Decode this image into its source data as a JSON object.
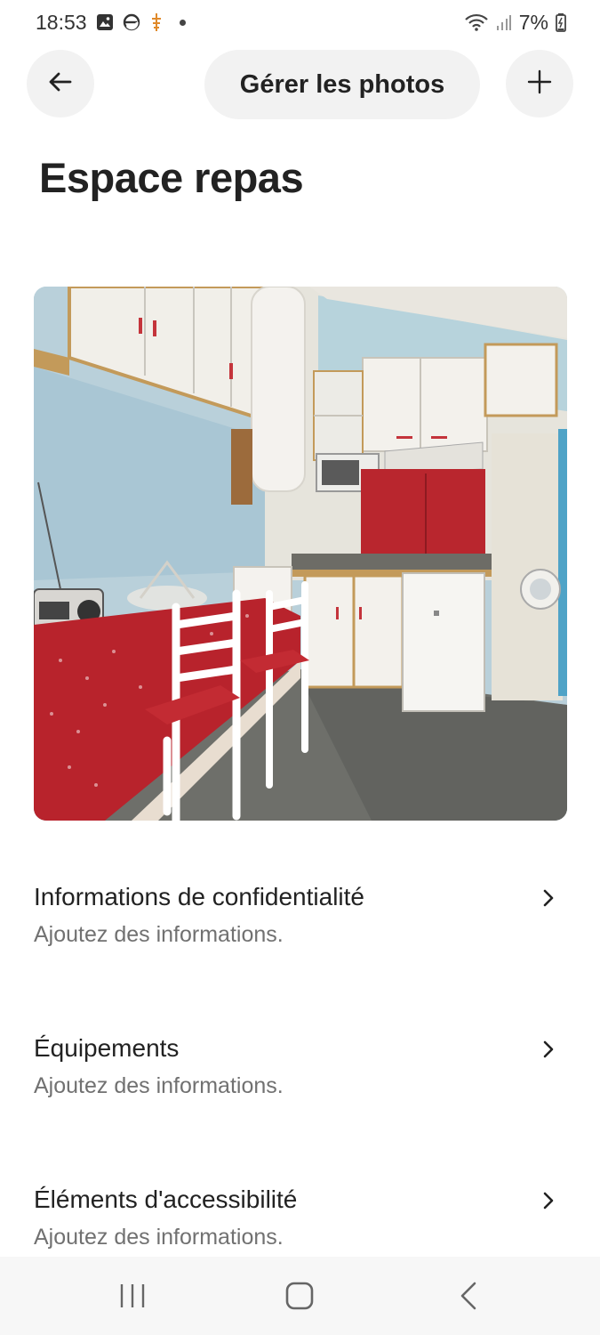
{
  "status_bar": {
    "time": "18:53",
    "battery": "7%",
    "icons": [
      "gallery-icon",
      "edge-browser-icon",
      "app-notification-icon",
      "dot",
      "wifi-icon",
      "signal-icon",
      "battery-charging-icon"
    ]
  },
  "header": {
    "back_icon": "arrow-left-icon",
    "manage_photos_label": "Gérer les photos",
    "add_icon": "plus-icon"
  },
  "page": {
    "title": "Espace repas"
  },
  "sections": [
    {
      "title": "Informations de confidentialité",
      "subtitle": "Ajoutez des informations."
    },
    {
      "title": "Équipements",
      "subtitle": "Ajoutez des informations."
    },
    {
      "title": "Éléments d'accessibilité",
      "subtitle": "Ajoutez des informations."
    }
  ],
  "nav_bar": {
    "items": [
      "recent-apps-icon",
      "home-icon",
      "back-icon"
    ]
  }
}
